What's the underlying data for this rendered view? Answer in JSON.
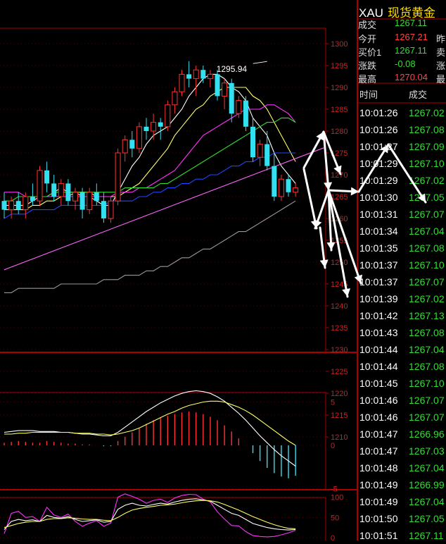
{
  "instrument": {
    "symbol": "XAU",
    "name": "现货黄金"
  },
  "quote": [
    {
      "label": "成交",
      "value": "1267.11",
      "extra": "",
      "color": "#33dd33"
    },
    {
      "label": "今开",
      "value": "1267.21",
      "extra": "昨",
      "color": "#ff4444"
    },
    {
      "label": "买价1",
      "value": "1267.11",
      "extra": "卖",
      "color": "#33dd33"
    },
    {
      "label": "涨跌",
      "value": "-0.08",
      "extra": "涨",
      "color": "#33dd33"
    },
    {
      "label": "最高",
      "value": "1270.04",
      "extra": "最",
      "color": "#ff4444"
    }
  ],
  "ticks": {
    "headers": {
      "time": "时间",
      "price": "成交"
    },
    "rows": [
      {
        "time": "10:01:26",
        "price": "1267.02"
      },
      {
        "time": "10:01:26",
        "price": "1267.08"
      },
      {
        "time": "10:01:27",
        "price": "1267.09"
      },
      {
        "time": "10:01:29",
        "price": "1267.10"
      },
      {
        "time": "10:01:29",
        "price": "1267.02"
      },
      {
        "time": "10:01:30",
        "price": "1267.05"
      },
      {
        "time": "10:01:31",
        "price": "1267.07"
      },
      {
        "time": "10:01:34",
        "price": "1267.04"
      },
      {
        "time": "10:01:35",
        "price": "1267.08"
      },
      {
        "time": "10:01:37",
        "price": "1267.10"
      },
      {
        "time": "10:01:37",
        "price": "1267.07"
      },
      {
        "time": "10:01:39",
        "price": "1267.02"
      },
      {
        "time": "10:01:42",
        "price": "1267.13"
      },
      {
        "time": "10:01:43",
        "price": "1267.08"
      },
      {
        "time": "10:01:44",
        "price": "1267.04"
      },
      {
        "time": "10:01:44",
        "price": "1267.08"
      },
      {
        "time": "10:01:45",
        "price": "1267.10"
      },
      {
        "time": "10:01:46",
        "price": "1267.07"
      },
      {
        "time": "10:01:46",
        "price": "1267.07"
      },
      {
        "time": "10:01:47",
        "price": "1266.96"
      },
      {
        "time": "10:01:47",
        "price": "1267.03"
      },
      {
        "time": "10:01:48",
        "price": "1267.04"
      },
      {
        "time": "10:01:49",
        "price": "1266.99"
      },
      {
        "time": "10:01:49",
        "price": "1267.04"
      },
      {
        "time": "10:01:50",
        "price": "1267.05"
      },
      {
        "time": "10:01:51",
        "price": "1267.11"
      }
    ]
  },
  "colors": {
    "up": "#ff3333",
    "down": "#33e0f0",
    "grid": "#aa0000",
    "ma5": "#ffffff",
    "ma10": "#ffff66",
    "ma20": "#ff33ff",
    "ma40": "#33dd33",
    "ma60": "#2244ff",
    "ma120": "#999999",
    "trend": "#ff66ff"
  },
  "chart_data": [
    {
      "type": "candlestick",
      "y_ticks": [
        "1300",
        "1295",
        "1290",
        "1285",
        "1280",
        "1275",
        "1270",
        "1265",
        "1260",
        "1255",
        "1250",
        "1245",
        "1240",
        "1235",
        "1230",
        "1225",
        "1220",
        "1215",
        "1210"
      ],
      "ylim": [
        1208,
        1302
      ],
      "annotation": {
        "text": "1295.94",
        "x_index": 37,
        "value": 1295.94
      },
      "candles": [
        {
          "o": 1264,
          "h": 1266,
          "l": 1260,
          "c": 1262
        },
        {
          "o": 1262,
          "h": 1265,
          "l": 1260,
          "c": 1264
        },
        {
          "o": 1264,
          "h": 1266,
          "l": 1261,
          "c": 1262
        },
        {
          "o": 1262,
          "h": 1266,
          "l": 1260,
          "c": 1265
        },
        {
          "o": 1265,
          "h": 1268,
          "l": 1263,
          "c": 1264
        },
        {
          "o": 1264,
          "h": 1272,
          "l": 1263,
          "c": 1271
        },
        {
          "o": 1271,
          "h": 1273,
          "l": 1266,
          "c": 1268
        },
        {
          "o": 1268,
          "h": 1270,
          "l": 1264,
          "c": 1265
        },
        {
          "o": 1265,
          "h": 1269,
          "l": 1263,
          "c": 1268
        },
        {
          "o": 1268,
          "h": 1269,
          "l": 1263,
          "c": 1264
        },
        {
          "o": 1264,
          "h": 1267,
          "l": 1262,
          "c": 1266
        },
        {
          "o": 1266,
          "h": 1267,
          "l": 1260,
          "c": 1262
        },
        {
          "o": 1262,
          "h": 1267,
          "l": 1261,
          "c": 1266
        },
        {
          "o": 1266,
          "h": 1268,
          "l": 1263,
          "c": 1264
        },
        {
          "o": 1264,
          "h": 1266,
          "l": 1259,
          "c": 1260
        },
        {
          "o": 1260,
          "h": 1265,
          "l": 1259,
          "c": 1264
        },
        {
          "o": 1264,
          "h": 1276,
          "l": 1263,
          "c": 1275
        },
        {
          "o": 1275,
          "h": 1279,
          "l": 1273,
          "c": 1278
        },
        {
          "o": 1278,
          "h": 1280,
          "l": 1274,
          "c": 1276
        },
        {
          "o": 1276,
          "h": 1282,
          "l": 1275,
          "c": 1281
        },
        {
          "o": 1281,
          "h": 1283,
          "l": 1278,
          "c": 1280
        },
        {
          "o": 1280,
          "h": 1284,
          "l": 1278,
          "c": 1282
        },
        {
          "o": 1282,
          "h": 1283,
          "l": 1278,
          "c": 1281
        },
        {
          "o": 1281,
          "h": 1287,
          "l": 1280,
          "c": 1286
        },
        {
          "o": 1286,
          "h": 1290,
          "l": 1284,
          "c": 1289
        },
        {
          "o": 1289,
          "h": 1294,
          "l": 1288,
          "c": 1293
        },
        {
          "o": 1293,
          "h": 1296,
          "l": 1290,
          "c": 1292
        },
        {
          "o": 1292,
          "h": 1295,
          "l": 1288,
          "c": 1294
        },
        {
          "o": 1294,
          "h": 1295,
          "l": 1291,
          "c": 1292
        },
        {
          "o": 1292,
          "h": 1294,
          "l": 1290,
          "c": 1293
        },
        {
          "o": 1293,
          "h": 1294,
          "l": 1287,
          "c": 1288
        },
        {
          "o": 1288,
          "h": 1292,
          "l": 1285,
          "c": 1291
        },
        {
          "o": 1291,
          "h": 1292,
          "l": 1282,
          "c": 1284
        },
        {
          "o": 1284,
          "h": 1288,
          "l": 1283,
          "c": 1287
        },
        {
          "o": 1287,
          "h": 1288,
          "l": 1280,
          "c": 1281
        },
        {
          "o": 1281,
          "h": 1283,
          "l": 1273,
          "c": 1274
        },
        {
          "o": 1274,
          "h": 1278,
          "l": 1272,
          "c": 1277
        },
        {
          "o": 1277,
          "h": 1280,
          "l": 1271,
          "c": 1272
        },
        {
          "o": 1272,
          "h": 1275,
          "l": 1264,
          "c": 1265
        },
        {
          "o": 1265,
          "h": 1270,
          "l": 1264,
          "c": 1269
        },
        {
          "o": 1269,
          "h": 1270,
          "l": 1265,
          "c": 1266
        },
        {
          "o": 1266,
          "h": 1268,
          "l": 1265,
          "c": 1267
        }
      ],
      "ma_lines": [
        {
          "key": "ma5",
          "values": [
            1263,
            1263,
            1263,
            1263,
            1264,
            1265,
            1265,
            1266,
            1267,
            1266,
            1266,
            1265,
            1265,
            1264,
            1263,
            1263,
            1266,
            1269,
            1272,
            1274,
            1277,
            1279,
            1280,
            1281,
            1283,
            1285,
            1288,
            1290,
            1292,
            1293,
            1293,
            1292,
            1290,
            1289,
            1287,
            1283,
            1281,
            1279,
            1275,
            1272,
            1270,
            1268
          ]
        },
        {
          "key": "ma10",
          "values": [
            1262,
            1262,
            1262,
            1262,
            1263,
            1263,
            1264,
            1264,
            1265,
            1265,
            1266,
            1266,
            1266,
            1265,
            1265,
            1265,
            1265,
            1266,
            1267,
            1268,
            1270,
            1272,
            1274,
            1276,
            1279,
            1281,
            1283,
            1285,
            1286,
            1288,
            1289,
            1290,
            1290,
            1290,
            1290,
            1288,
            1287,
            1285,
            1282,
            1279,
            1276,
            1273
          ]
        },
        {
          "key": "ma20",
          "values": [
            1266,
            1266,
            1266,
            1265,
            1265,
            1265,
            1265,
            1265,
            1265,
            1265,
            1265,
            1265,
            1265,
            1265,
            1265,
            1265,
            1266,
            1266,
            1266,
            1267,
            1267,
            1268,
            1269,
            1270,
            1271,
            1273,
            1275,
            1277,
            1279,
            1280,
            1281,
            1282,
            1283,
            1284,
            1285,
            1285,
            1285,
            1286,
            1286,
            1285,
            1284,
            1282
          ]
        },
        {
          "key": "ma40",
          "values": [
            1264,
            1264,
            1265,
            1265,
            1265,
            1265,
            1265,
            1266,
            1266,
            1266,
            1266,
            1266,
            1266,
            1266,
            1266,
            1266,
            1266,
            1267,
            1267,
            1267,
            1267,
            1267,
            1268,
            1268,
            1269,
            1270,
            1271,
            1272,
            1273,
            1274,
            1275,
            1276,
            1277,
            1278,
            1279,
            1280,
            1281,
            1282,
            1282,
            1283,
            1283,
            1282
          ]
        },
        {
          "key": "ma60",
          "values": [
            1260,
            1261,
            1261,
            1261,
            1262,
            1262,
            1262,
            1262,
            1263,
            1263,
            1263,
            1263,
            1263,
            1263,
            1263,
            1264,
            1264,
            1264,
            1264,
            1265,
            1265,
            1266,
            1266,
            1267,
            1267,
            1268,
            1268,
            1269,
            1269,
            1270,
            1270,
            1271,
            1272,
            1272,
            1273,
            1273,
            1274,
            1274,
            1275,
            1275,
            1275,
            1275
          ]
        },
        {
          "key": "ma120",
          "values": [
            1243,
            1243,
            1244,
            1244,
            1244,
            1244,
            1244,
            1244,
            1245,
            1245,
            1245,
            1245,
            1245,
            1245,
            1246,
            1246,
            1246,
            1247,
            1247,
            1247,
            1248,
            1248,
            1249,
            1249,
            1250,
            1251,
            1251,
            1252,
            1253,
            1253,
            1254,
            1255,
            1256,
            1257,
            1257,
            1258,
            1259,
            1260,
            1261,
            1262,
            1263,
            1264
          ]
        }
      ],
      "trendline": {
        "from": [
          0,
          1256
        ],
        "to": [
          41,
          1276
        ]
      },
      "arrows": [
        [
          432,
          238,
          460,
          187
        ],
        [
          432,
          240,
          450,
          324
        ],
        [
          460,
          187,
          467,
          270
        ],
        [
          460,
          187,
          484,
          247
        ],
        [
          467,
          270,
          448,
          324
        ],
        [
          467,
          270,
          471,
          355
        ],
        [
          467,
          270,
          494,
          421
        ],
        [
          467,
          270,
          513,
          402
        ],
        [
          467,
          270,
          510,
          272
        ],
        [
          510,
          272,
          552,
          205
        ],
        [
          552,
          205,
          605,
          287
        ],
        [
          455,
          323,
          462,
          380
        ]
      ]
    },
    {
      "type": "bar+line",
      "y_ticks": [
        "5",
        "0",
        "-5"
      ],
      "ylim": [
        -7,
        8
      ],
      "histogram": [
        0.3,
        0.4,
        0.5,
        0.4,
        0.3,
        0.3,
        0.5,
        0.4,
        0.3,
        0.2,
        0.2,
        0.1,
        0.1,
        0.0,
        -0.1,
        -0.1,
        0.5,
        1.0,
        1.5,
        2.0,
        2.5,
        2.9,
        3.2,
        3.4,
        3.6,
        3.8,
        3.9,
        3.8,
        3.6,
        3.3,
        2.9,
        2.3,
        1.6,
        0.8,
        0.0,
        -0.9,
        -1.8,
        -2.6,
        -3.2,
        -3.6,
        -3.8,
        -3.5
      ],
      "dif": [
        1.5,
        1.6,
        1.7,
        1.7,
        1.7,
        1.6,
        1.6,
        1.6,
        1.5,
        1.5,
        1.4,
        1.3,
        1.3,
        1.2,
        1.1,
        1.1,
        1.5,
        2.1,
        2.7,
        3.3,
        3.9,
        4.4,
        4.9,
        5.3,
        5.7,
        6.0,
        6.2,
        6.3,
        6.2,
        6.0,
        5.6,
        5.1,
        4.4,
        3.7,
        2.9,
        2.0,
        1.1,
        0.3,
        -0.5,
        -1.2,
        -1.8,
        -2.4
      ],
      "dea": [
        1.3,
        1.3,
        1.4,
        1.4,
        1.5,
        1.5,
        1.5,
        1.5,
        1.5,
        1.5,
        1.4,
        1.4,
        1.4,
        1.3,
        1.3,
        1.2,
        1.3,
        1.5,
        1.7,
        2.0,
        2.4,
        2.8,
        3.2,
        3.6,
        3.9,
        4.3,
        4.6,
        4.8,
        5.0,
        5.1,
        5.1,
        5.0,
        4.7,
        4.4,
        4.0,
        3.5,
        2.9,
        2.3,
        1.7,
        1.1,
        0.5,
        0.0
      ]
    },
    {
      "type": "line",
      "y_ticks": [
        "100",
        "50",
        "0"
      ],
      "ylim": [
        -5,
        112
      ],
      "k": [
        20,
        40,
        45,
        42,
        44,
        40,
        55,
        50,
        48,
        52,
        45,
        40,
        42,
        44,
        38,
        40,
        70,
        80,
        85,
        80,
        78,
        82,
        85,
        83,
        88,
        92,
        95,
        96,
        93,
        90,
        80,
        70,
        60,
        55,
        45,
        35,
        30,
        25,
        22,
        20,
        19,
        20
      ],
      "d": [
        25,
        30,
        35,
        38,
        40,
        40,
        45,
        47,
        47,
        49,
        48,
        46,
        45,
        45,
        43,
        42,
        50,
        60,
        68,
        72,
        75,
        77,
        80,
        81,
        83,
        86,
        89,
        91,
        92,
        91,
        88,
        82,
        75,
        68,
        60,
        52,
        45,
        38,
        32,
        27,
        23,
        22
      ],
      "j": [
        10,
        60,
        65,
        50,
        52,
        40,
        75,
        56,
        50,
        58,
        40,
        28,
        36,
        42,
        28,
        36,
        100,
        108,
        102,
        95,
        85,
        92,
        95,
        87,
        98,
        104,
        107,
        106,
        95,
        88,
        64,
        46,
        30,
        29,
        15,
        5,
        3,
        2,
        3,
        7,
        12,
        18
      ]
    }
  ]
}
